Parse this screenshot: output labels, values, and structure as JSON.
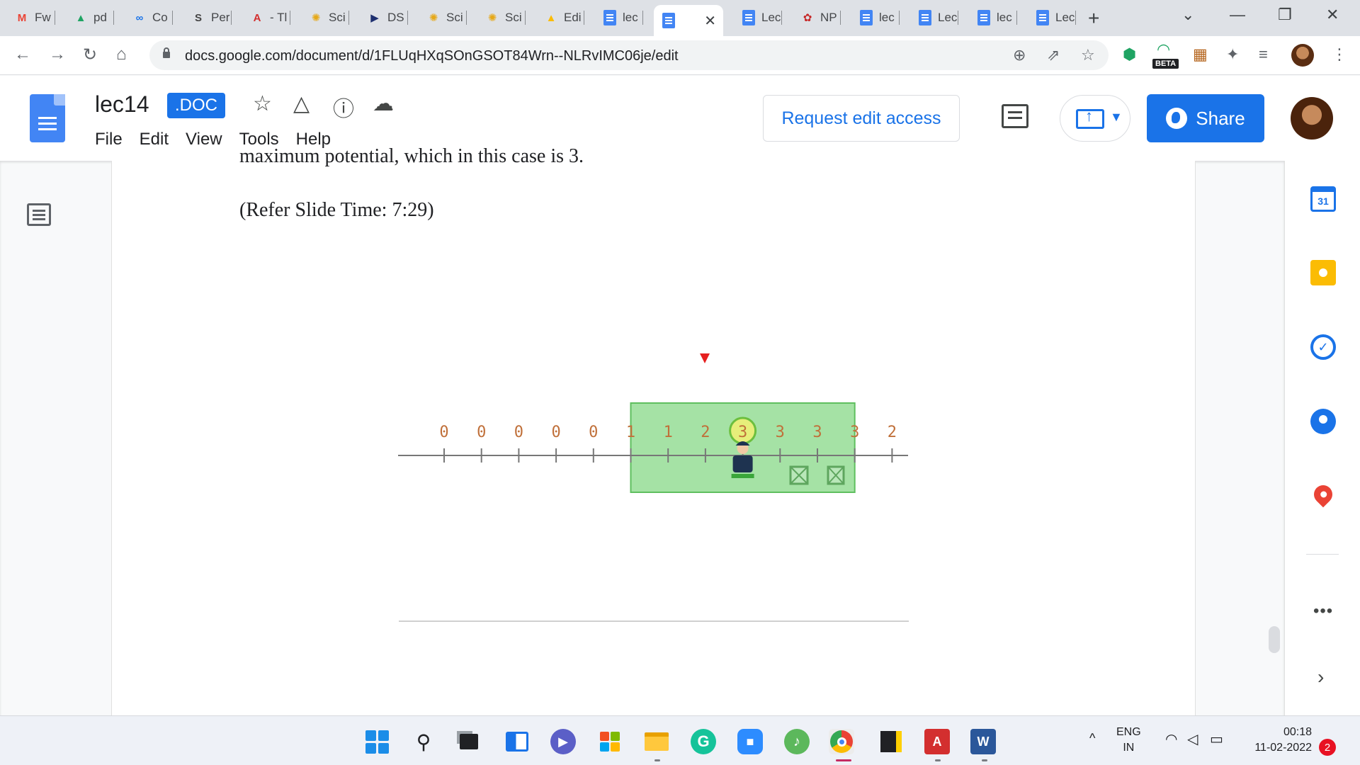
{
  "browser": {
    "tabs": [
      {
        "label": "Fw",
        "icon": "gmail-icon",
        "glyph": "M",
        "color": "#ea4335"
      },
      {
        "label": "pd",
        "icon": "drive-icon",
        "glyph": "▲",
        "color": "#1fa463"
      },
      {
        "label": "Co",
        "icon": "link-icon",
        "glyph": "∞",
        "color": "#1a73e8"
      },
      {
        "label": "Per",
        "icon": "perplexity-icon",
        "glyph": "S",
        "color": "#444"
      },
      {
        "label": "- Tl",
        "icon": "acrobat-icon",
        "glyph": "A",
        "color": "#d32f2f"
      },
      {
        "label": "Sci",
        "icon": "scihub-icon",
        "glyph": "✺",
        "color": "#e6a817"
      },
      {
        "label": "DS",
        "icon": "arrow-icon",
        "glyph": "▶",
        "color": "#1d2f6f"
      },
      {
        "label": "Sci",
        "icon": "scihub-icon",
        "glyph": "✺",
        "color": "#e6a817"
      },
      {
        "label": "Sci",
        "icon": "scihub-icon",
        "glyph": "✺",
        "color": "#e6a817"
      },
      {
        "label": "Edi",
        "icon": "drive-icon",
        "glyph": "▲",
        "color": "#fbbc04"
      },
      {
        "label": "lec",
        "icon": "docs-icon",
        "glyph": "",
        "color": "#4285f4"
      },
      {
        "label": "",
        "icon": "docs-icon",
        "glyph": "",
        "color": "#4285f4",
        "active": true
      },
      {
        "label": "Lec",
        "icon": "docs-icon",
        "glyph": "",
        "color": "#4285f4"
      },
      {
        "label": "NP",
        "icon": "nptel-icon",
        "glyph": "✿",
        "color": "#c62828"
      },
      {
        "label": "lec",
        "icon": "docs-icon",
        "glyph": "",
        "color": "#4285f4"
      },
      {
        "label": "Lec",
        "icon": "docs-icon",
        "glyph": "",
        "color": "#4285f4"
      },
      {
        "label": "lec",
        "icon": "docs-icon",
        "glyph": "",
        "color": "#4285f4"
      },
      {
        "label": "Lec",
        "icon": "docs-icon",
        "glyph": "",
        "color": "#4285f4"
      }
    ],
    "url": "docs.google.com/document/d/1FLUqHXqSOnGSOT84Wrn--NLRvIMC06je/edit",
    "beta_label": "BETA"
  },
  "docs": {
    "title": "lec14",
    "badge": ".DOC",
    "menu": [
      "File",
      "Edit",
      "View",
      "Tools",
      "Help"
    ],
    "request_edit_label": "Request edit access",
    "share_label": "Share",
    "accent": "#1a73e8"
  },
  "document": {
    "cut_text": "maximum potential, which in this case is 3.",
    "refer_text": "(Refer Slide Time: 7:29)"
  },
  "figure": {
    "numbers": [
      "0",
      "0",
      "0",
      "0",
      "0",
      "1",
      "1",
      "2",
      "3",
      "3",
      "3",
      "3",
      "2"
    ],
    "highlight_index": 8,
    "window_start": 5,
    "window_end": 11
  },
  "sidepanel": {
    "calendar_day": "31",
    "more": "•••"
  },
  "taskbar": {
    "lang_top": "ENG",
    "lang_bottom": "IN",
    "time": "00:18",
    "date": "11-02-2022",
    "notifications": "2"
  }
}
